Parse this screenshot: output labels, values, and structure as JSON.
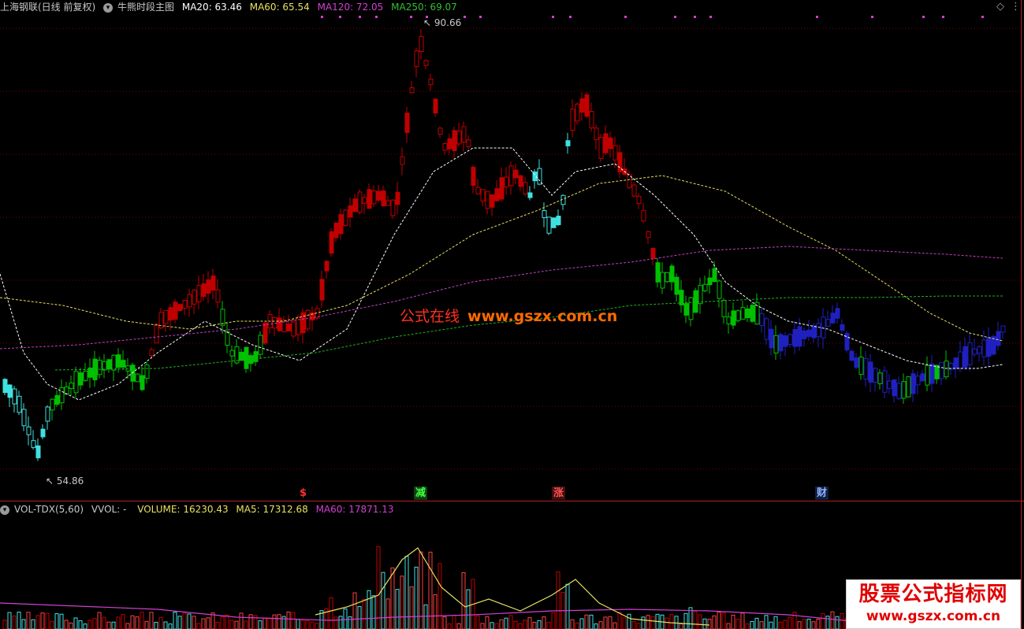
{
  "main_header": {
    "stock": "上海钢联(日线 前复权)",
    "indicator": "牛熊时段主图",
    "ma20": "MA20: 63.46",
    "ma60": "MA60: 65.54",
    "ma120": "MA120: 72.05",
    "ma250": "MA250: 69.07"
  },
  "vol_header": {
    "name": "VOL-TDX(5,60)",
    "vvol": "VVOL: -",
    "volume": "VOLUME: 16230.43",
    "ma5": "MA5: 17312.68",
    "ma60": "MA60: 17871.13"
  },
  "price_labels": {
    "high": "90.66",
    "low": "54.86"
  },
  "signals": [
    {
      "label": "$",
      "color": "#ff3030"
    },
    {
      "label": "减",
      "color": "#40ff40"
    },
    {
      "label": "涨",
      "color": "#ff4040"
    },
    {
      "label": "财",
      "color": "#8fb0ff"
    }
  ],
  "watermark": {
    "cn": "公式在线",
    "url": "www.gszx.com.cn"
  },
  "logo": {
    "line1": "股票公式指标网",
    "line2": "www.gszx.com.cn"
  },
  "icons": [
    "diamond-icon",
    "more-icon"
  ],
  "colors": {
    "bull": "#c00000",
    "bear_cyan": "#40e0e0",
    "green": "#00c000",
    "blue": "#2020c0",
    "ma20": "#ffffff",
    "ma60": "#e8e060",
    "ma120": "#c040c0",
    "ma250": "#20b020"
  },
  "chart_data": {
    "type": "candlestick",
    "y_range": [
      54.86,
      90.66
    ],
    "high": 90.66,
    "low": 54.86,
    "moving_averages": [
      {
        "name": "MA20",
        "value": 63.46
      },
      {
        "name": "MA60",
        "value": 65.54
      },
      {
        "name": "MA120",
        "value": 72.05
      },
      {
        "name": "MA250",
        "value": 69.07
      }
    ],
    "volume": {
      "last": 16230.43,
      "ma5": 17312.68,
      "ma60": 17871.13
    }
  }
}
